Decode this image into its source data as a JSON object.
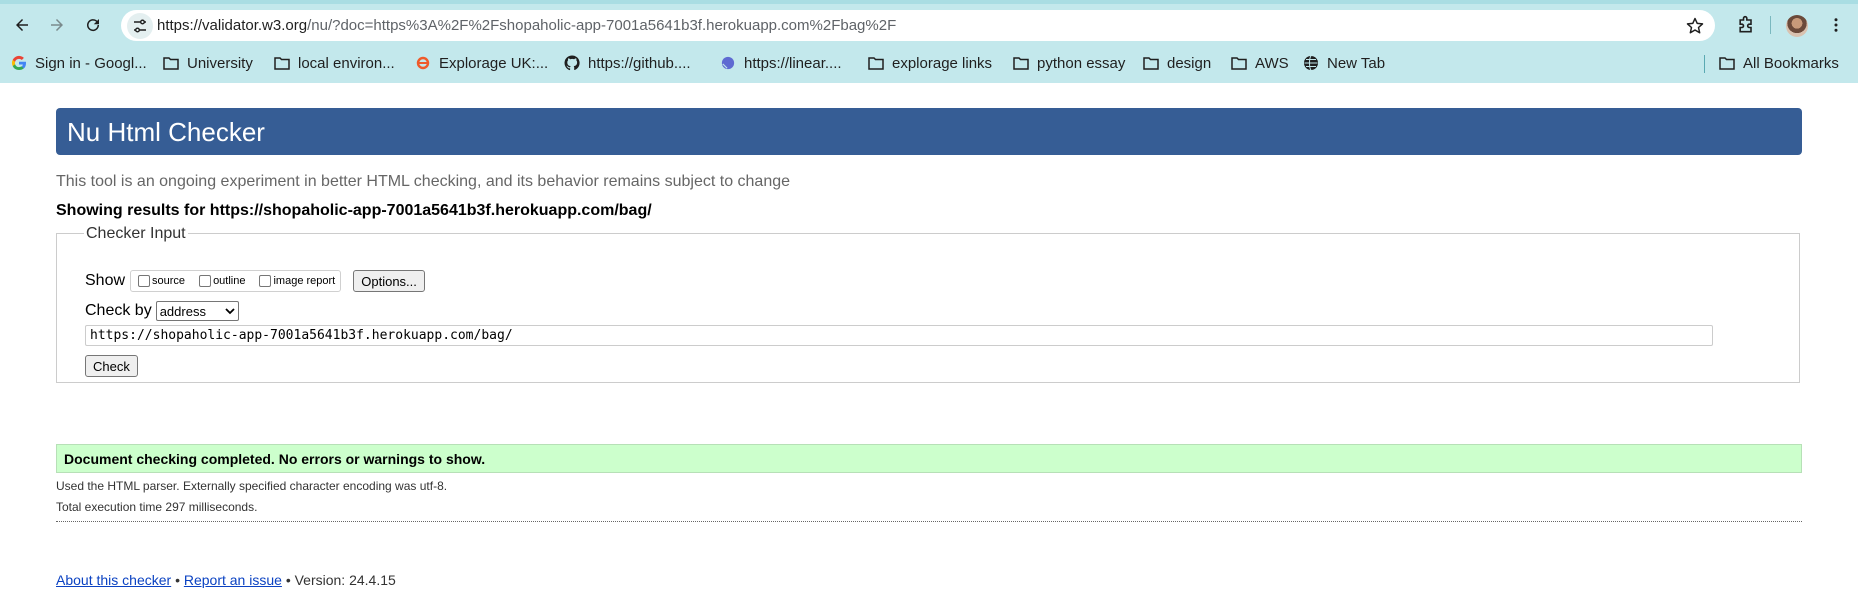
{
  "browser": {
    "url_host": "https://validator.w3.org",
    "url_rest": "/nu/?doc=https%3A%2F%2Fshopaholic-app-7001a5641b3f.herokuapp.com%2Fbag%2F",
    "bookmarks": [
      {
        "label": "Sign in - Googl...",
        "icon": "google-icon"
      },
      {
        "label": "University",
        "icon": "folder-icon"
      },
      {
        "label": "local environ...",
        "icon": "folder-icon"
      },
      {
        "label": "Explorage UK:...",
        "icon": "explorage-icon"
      },
      {
        "label": "https://github....",
        "icon": "github-icon"
      },
      {
        "label": "https://linear....",
        "icon": "linear-icon"
      },
      {
        "label": "explorage links",
        "icon": "folder-icon"
      },
      {
        "label": "python essay",
        "icon": "folder-icon"
      },
      {
        "label": "design",
        "icon": "folder-icon"
      },
      {
        "label": "AWS",
        "icon": "folder-icon"
      },
      {
        "label": "New Tab",
        "icon": "globe-icon"
      }
    ],
    "all_bookmarks": "All Bookmarks"
  },
  "page": {
    "title": "Nu Html Checker",
    "intro": "This tool is an ongoing experiment in better HTML checking, and its behavior remains subject to change",
    "showing_results": "Showing results for https://shopaholic-app-7001a5641b3f.herokuapp.com/bag/",
    "checker_input": {
      "legend": "Checker Input",
      "show_label": "Show",
      "options": [
        "source",
        "outline",
        "image report"
      ],
      "options_button": "Options...",
      "check_by_label": "Check by",
      "check_by_value": "address",
      "url_value": "https://shopaholic-app-7001a5641b3f.herokuapp.com/bag/",
      "check_button": "Check"
    },
    "result_message": "Document checking completed. No errors or warnings to show.",
    "parser_note": "Used the HTML parser. Externally specified character encoding was utf-8.",
    "execution_time": "Total execution time 297 milliseconds.",
    "footer": {
      "about": "About this checker",
      "sep": "•",
      "report": "Report an issue",
      "version": "• Version: 24.4.15"
    }
  },
  "colors": {
    "chrome_bg": "#c3e8ec",
    "header_bg": "#365d95",
    "success_bg": "#ccffcc",
    "link": "#0b42c2"
  }
}
